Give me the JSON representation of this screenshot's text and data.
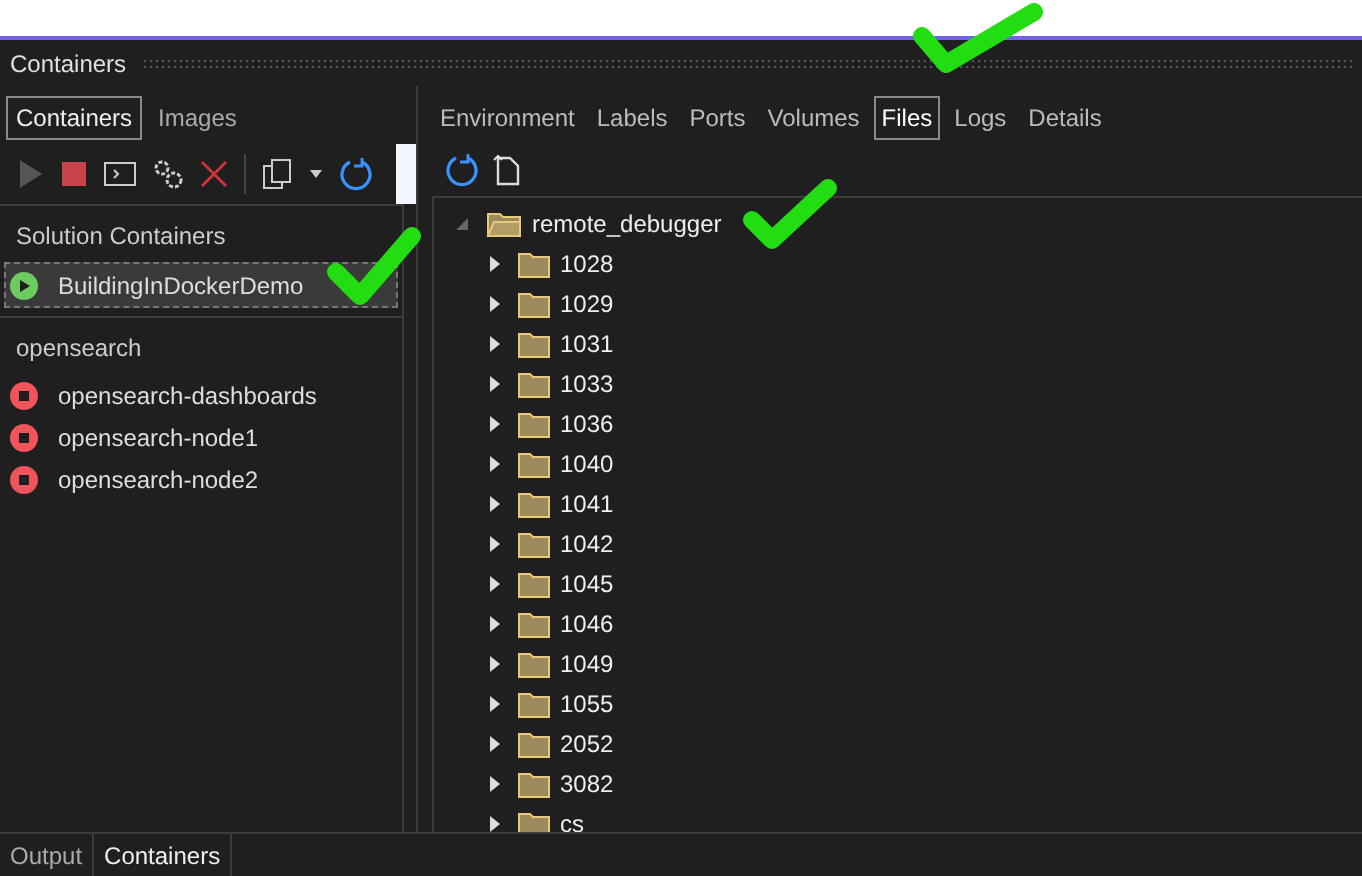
{
  "window": {
    "title": "Containers"
  },
  "left_tabs": [
    {
      "label": "Containers",
      "selected": true
    },
    {
      "label": "Images",
      "selected": false
    }
  ],
  "groups": [
    {
      "name": "Solution Containers",
      "containers": [
        {
          "name": "BuildingInDockerDemo",
          "kind": "running",
          "selected": true
        }
      ]
    },
    {
      "name": "opensearch",
      "containers": [
        {
          "name": "opensearch-dashboards",
          "kind": "stopped",
          "selected": false
        },
        {
          "name": "opensearch-node1",
          "kind": "stopped",
          "selected": false
        },
        {
          "name": "opensearch-node2",
          "kind": "stopped",
          "selected": false
        }
      ]
    }
  ],
  "detail_tabs": [
    {
      "label": "Environment",
      "selected": false
    },
    {
      "label": "Labels",
      "selected": false
    },
    {
      "label": "Ports",
      "selected": false
    },
    {
      "label": "Volumes",
      "selected": false
    },
    {
      "label": "Files",
      "selected": true
    },
    {
      "label": "Logs",
      "selected": false
    },
    {
      "label": "Details",
      "selected": false
    }
  ],
  "files": {
    "name": "remote_debugger",
    "expanded": true,
    "children": [
      {
        "name": "1028",
        "expanded": false
      },
      {
        "name": "1029",
        "expanded": false
      },
      {
        "name": "1031",
        "expanded": false
      },
      {
        "name": "1033",
        "expanded": false
      },
      {
        "name": "1036",
        "expanded": false
      },
      {
        "name": "1040",
        "expanded": false
      },
      {
        "name": "1041",
        "expanded": false
      },
      {
        "name": "1042",
        "expanded": false
      },
      {
        "name": "1045",
        "expanded": false
      },
      {
        "name": "1046",
        "expanded": false
      },
      {
        "name": "1049",
        "expanded": false
      },
      {
        "name": "1055",
        "expanded": false
      },
      {
        "name": "2052",
        "expanded": false
      },
      {
        "name": "3082",
        "expanded": false
      },
      {
        "name": "cs",
        "expanded": false
      }
    ]
  },
  "bottom_tabs": [
    {
      "label": "Output",
      "selected": false
    },
    {
      "label": "Containers",
      "selected": true
    }
  ]
}
